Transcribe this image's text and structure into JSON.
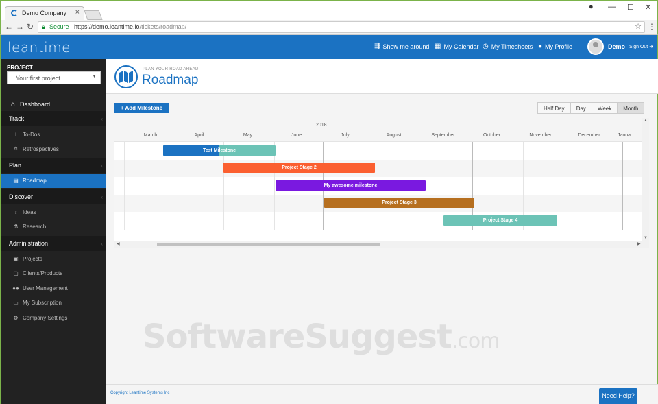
{
  "browser": {
    "tab_title": "Demo Company",
    "secure_label": "Secure",
    "url_host": "https://demo.leantime.io",
    "url_path": "/tickets/roadmap/"
  },
  "header": {
    "logo": "leantime",
    "nav": [
      {
        "label": "Show me around",
        "icon": "signpost-icon"
      },
      {
        "label": "My Calendar",
        "icon": "calendar-icon"
      },
      {
        "label": "My Timesheets",
        "icon": "clock-icon"
      },
      {
        "label": "My Profile",
        "icon": "user-icon"
      }
    ],
    "username": "Demo",
    "signout": "Sign Out",
    "accent": "#1b72c2"
  },
  "sidebar": {
    "project_label": "PROJECT",
    "project_value": "Your first project",
    "dashboard": "Dashboard",
    "sections": {
      "track": "Track",
      "plan": "Plan",
      "discover": "Discover",
      "administration": "Administration"
    },
    "items": {
      "todos": "To-Dos",
      "retrospectives": "Retrospectives",
      "roadmap": "Roadmap",
      "ideas": "Ideas",
      "research": "Research",
      "projects": "Projects",
      "clients": "Clients/Products",
      "user_management": "User Management",
      "subscription": "My Subscription",
      "company_settings": "Company Settings"
    }
  },
  "page": {
    "subtitle": "PLAN YOUR ROAD AHEAD",
    "title": "Roadmap",
    "add_button": "+ Add Milestone",
    "scales": [
      "Half Day",
      "Day",
      "Week",
      "Month"
    ],
    "active_scale": "Month"
  },
  "gantt": {
    "year": "2018",
    "months": [
      "March",
      "April",
      "May",
      "June",
      "July",
      "August",
      "September",
      "October",
      "November",
      "December",
      "Janua"
    ],
    "milestones": [
      {
        "name": "Test Milestone",
        "color": "#6cc3b6",
        "progress_color": "#1b72c2",
        "progress": 0.5
      },
      {
        "name": "Project Stage 2",
        "color": "#fb5f30"
      },
      {
        "name": "My awesome milestone",
        "color": "#7a19e0"
      },
      {
        "name": "Project Stage 3",
        "color": "#b66f1f"
      },
      {
        "name": "Project Stage 4",
        "color": "#6cc3b6"
      }
    ]
  },
  "watermark": {
    "main": "SoftwareSuggest",
    "suffix": ".com"
  },
  "footer": {
    "copyright": "Copyright Leantime Systems Inc",
    "help": "Need Help?"
  }
}
